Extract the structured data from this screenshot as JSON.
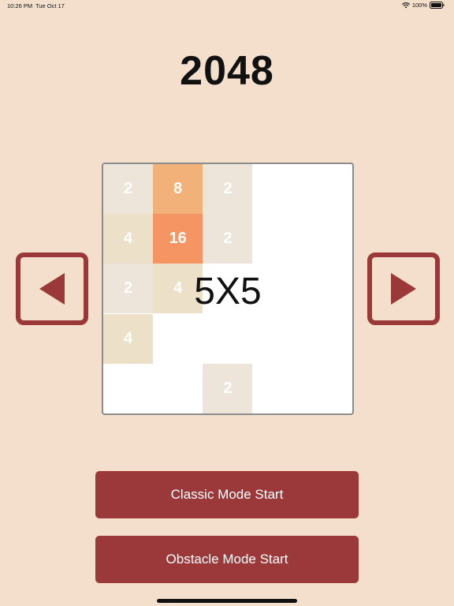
{
  "status_bar": {
    "time": "10:26 PM",
    "date": "Tue Oct 17",
    "battery": "100%"
  },
  "title": "2048",
  "board": {
    "size_label": "5X5",
    "tiles": [
      {
        "row": 0,
        "col": 0,
        "value": "2",
        "color": "#ede4da"
      },
      {
        "row": 0,
        "col": 1,
        "value": "8",
        "color": "#f2b179"
      },
      {
        "row": 0,
        "col": 2,
        "value": "2",
        "color": "#ede4da"
      },
      {
        "row": 1,
        "col": 0,
        "value": "4",
        "color": "#ede0c8"
      },
      {
        "row": 1,
        "col": 1,
        "value": "16",
        "color": "#f59563"
      },
      {
        "row": 1,
        "col": 2,
        "value": "2",
        "color": "#ede4da"
      },
      {
        "row": 2,
        "col": 0,
        "value": "2",
        "color": "#ede4da"
      },
      {
        "row": 2,
        "col": 1,
        "value": "4",
        "color": "#ede0c8"
      },
      {
        "row": 3,
        "col": 0,
        "value": "4",
        "color": "#ede0c8"
      },
      {
        "row": 4,
        "col": 2,
        "value": "2",
        "color": "#ede4da"
      }
    ]
  },
  "nav": {
    "prev_icon": "triangle-left-icon",
    "next_icon": "triangle-right-icon"
  },
  "buttons": {
    "classic": "Classic Mode Start",
    "obstacle": "Obstacle Mode Start"
  },
  "colors": {
    "background": "#f3dfcb",
    "accent": "#9b393a",
    "board_border": "#8c8c8c"
  }
}
